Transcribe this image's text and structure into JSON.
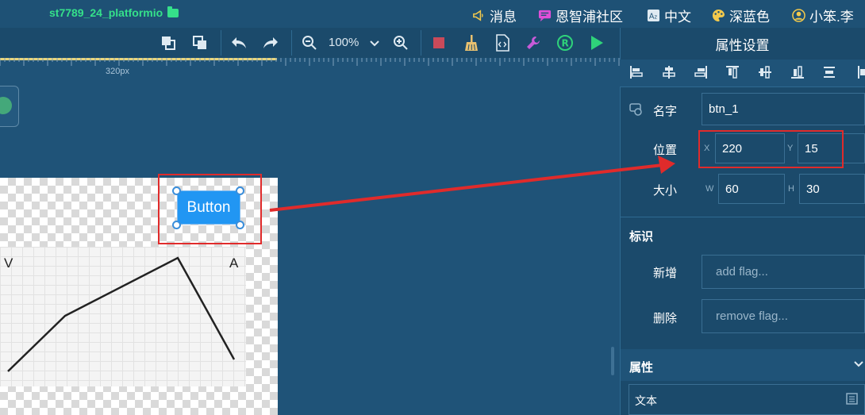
{
  "project": {
    "name": "st7789_24_platformio",
    "icon": "folder-icon"
  },
  "top_menu": [
    {
      "label": "消息",
      "icon": "megaphone-icon",
      "color": "#f2c94c"
    },
    {
      "label": "恩智浦社区",
      "icon": "chat-icon",
      "color": "#e04fd8"
    },
    {
      "label": "中文",
      "icon": "translate-icon",
      "color": "#dfeaf2"
    },
    {
      "label": "深蓝色",
      "icon": "palette-icon",
      "color": "#f2c94c"
    },
    {
      "label": "小笨.李",
      "icon": "user-icon",
      "color": "#f2c94c"
    }
  ],
  "toolbar": {
    "zoom": "100%",
    "icons": [
      "bring-front-icon",
      "send-back-icon",
      "undo-icon",
      "redo-icon",
      "zoom-out-icon",
      "zoom-dropdown-icon",
      "zoom-in-icon",
      "stop-icon",
      "clean-icon",
      "code-icon",
      "tool-icon",
      "register-icon",
      "run-icon"
    ]
  },
  "ruler": {
    "label": "320px"
  },
  "canvas": {
    "button_text": "Button",
    "chart_left_label": "V",
    "chart_right_label": "A"
  },
  "panel": {
    "title": "属性设置",
    "name_label": "名字",
    "name_value": "btn_1",
    "position_label": "位置",
    "x_label": "X",
    "x_value": "220",
    "y_label": "Y",
    "y_value": "15",
    "size_label": "大小",
    "w_label": "W",
    "w_value": "60",
    "h_label": "H",
    "h_value": "30",
    "flags_title": "标识",
    "add_label": "新增",
    "add_placeholder": "add flag...",
    "remove_label": "删除",
    "remove_placeholder": "remove flag...",
    "props_title": "属性",
    "text_label": "文本"
  },
  "colors": {
    "background": "#1f5378",
    "accent_green": "#35e08a",
    "widget_blue": "#2196f3",
    "highlight_red": "#e02b2b",
    "run_green": "#2fd37a",
    "stop_red": "#c94a5a"
  }
}
